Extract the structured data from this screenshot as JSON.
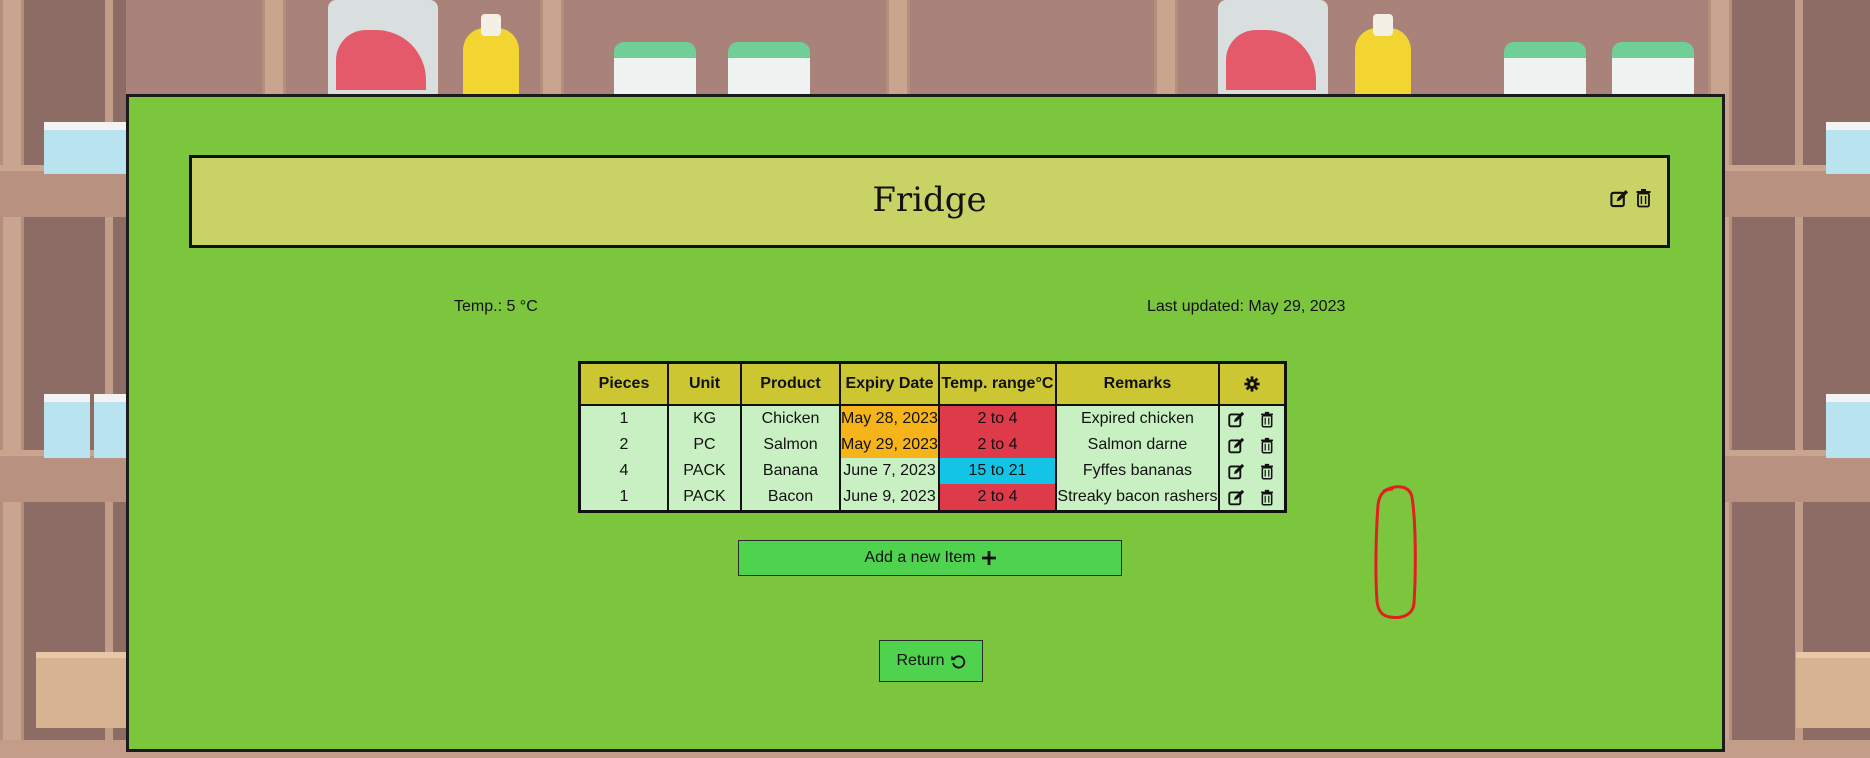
{
  "storage": {
    "name": "Fridge",
    "temp_label": "Temp.: 5 °C",
    "last_updated_label": "Last updated: May 29, 2023"
  },
  "table": {
    "headers": [
      "Pieces",
      "Unit",
      "Product",
      "Expiry Date",
      "Temp. range°C",
      "Remarks"
    ],
    "settings_icon": "gear-icon",
    "rows": [
      {
        "pieces": "1",
        "unit": "KG",
        "product": "Chicken",
        "expiry": "May 28, 2023",
        "expiry_color": "#f6b41a",
        "range": "2 to 4",
        "range_color": "#de3a4a",
        "remarks": "Expired chicken"
      },
      {
        "pieces": "2",
        "unit": "PC",
        "product": "Salmon",
        "expiry": "May 29, 2023",
        "expiry_color": "#f6b41a",
        "range": "2 to 4",
        "range_color": "#de3a4a",
        "remarks": "Salmon darne"
      },
      {
        "pieces": "4",
        "unit": "PACK",
        "product": "Banana",
        "expiry": "June 7, 2023",
        "expiry_color": "#c9f0c2",
        "range": "15 to 21",
        "range_color": "#12c5e6",
        "remarks": "Fyffes bananas"
      },
      {
        "pieces": "1",
        "unit": "PACK",
        "product": "Bacon",
        "expiry": "June 9, 2023",
        "expiry_color": "#c9f0c2",
        "range": "2 to 4",
        "range_color": "#de3a4a",
        "remarks": "Streaky bacon rashers"
      }
    ],
    "row_actions": [
      "edit-icon",
      "trash-icon"
    ]
  },
  "buttons": {
    "add_label": "Add a new Item",
    "add_icon": "plus-icon",
    "return_label": "Return",
    "return_icon": "rotate-icon"
  },
  "colors": {
    "panel": "#7cc63e",
    "title_bar": "#c9d264",
    "header": "#cbc632",
    "row": "#c9f0c2",
    "button": "#4fd34e",
    "annotation": "#e02020"
  }
}
